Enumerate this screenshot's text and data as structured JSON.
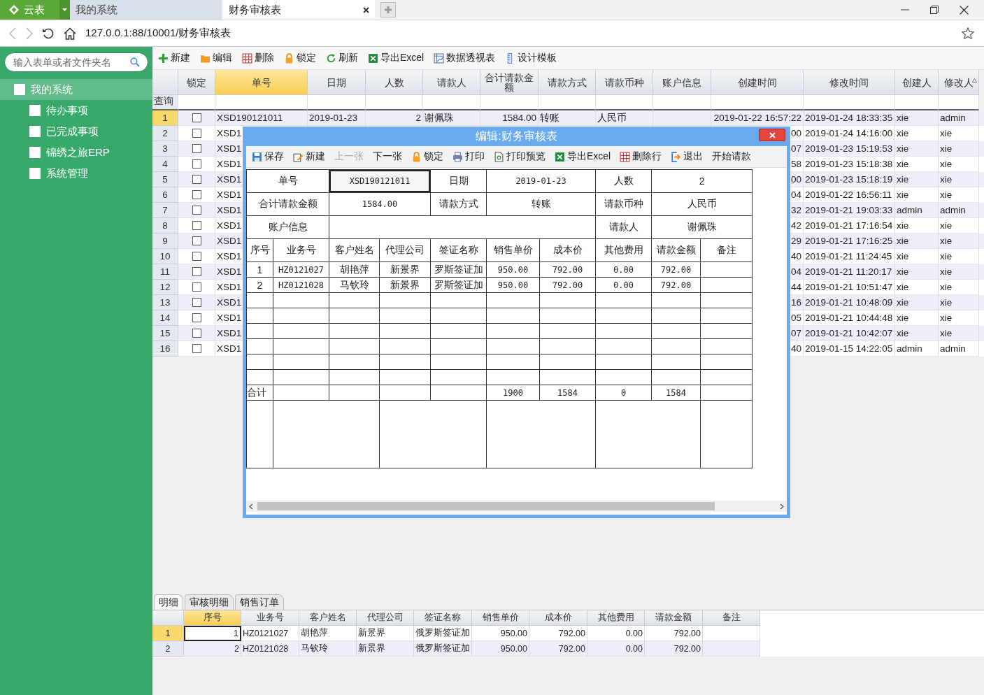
{
  "app_tab": {
    "label": "云表"
  },
  "tabs": [
    {
      "label": "我的系统",
      "selected": false
    },
    {
      "label": "财务审核表",
      "selected": true
    }
  ],
  "address": {
    "url": "127.0.0.1:88/10001/财务审核表"
  },
  "sidebar": {
    "search_placeholder": "输入表单或者文件夹名",
    "tree": [
      {
        "label": "我的系统",
        "selected": true,
        "children": [
          {
            "label": "待办事项",
            "selected": false
          },
          {
            "label": "已完成事项",
            "selected": false
          },
          {
            "label": "锦绣之旅ERP",
            "selected": false
          },
          {
            "label": "系统管理",
            "selected": false
          }
        ]
      }
    ]
  },
  "toolbar": [
    {
      "label": "新建",
      "kind": "plus"
    },
    {
      "label": "编辑",
      "kind": "folder"
    },
    {
      "label": "删除",
      "kind": "table"
    },
    {
      "label": "锁定",
      "kind": "lock"
    },
    {
      "label": "刷新",
      "kind": "refresh"
    },
    {
      "label": "导出Excel",
      "kind": "excel"
    },
    {
      "label": "数据透视表",
      "kind": "pivot"
    },
    {
      "label": "设计模板",
      "kind": "ruler"
    }
  ],
  "grid": {
    "query_label": "查询",
    "columns": [
      {
        "label": "锁定",
        "selected": false
      },
      {
        "label": "单号",
        "selected": true
      },
      {
        "label": "日期",
        "selected": false
      },
      {
        "label": "人数",
        "selected": false
      },
      {
        "label": "请款人",
        "selected": false
      },
      {
        "label": "合计请款金额",
        "selected": false
      },
      {
        "label": "请款方式",
        "selected": false
      },
      {
        "label": "请款币种",
        "selected": false
      },
      {
        "label": "账户信息",
        "selected": false
      },
      {
        "label": "创建时间",
        "selected": false
      },
      {
        "label": "修改时间",
        "selected": false
      },
      {
        "label": "创建人",
        "selected": false
      },
      {
        "label": "修改人",
        "selected": false
      }
    ],
    "rows": [
      {
        "index": "1",
        "selected": true,
        "locked": false,
        "order_no": "XSD190121011",
        "date": "2019-01-23",
        "people": "2",
        "requester": "谢佩珠",
        "total": "1584.00",
        "method": "转账",
        "currency": "人民币",
        "created": "2019-01-22 16:57:22",
        "modified": "2019-01-24 18:33:35",
        "creator": "xie",
        "modifier": "admin"
      },
      {
        "index": "2",
        "selected": false,
        "locked": false,
        "order_no": "XSD1",
        "created": "00",
        "modified": "2019-01-24 14:16:00",
        "creator": "xie",
        "modifier": "xie"
      },
      {
        "index": "3",
        "selected": false,
        "locked": false,
        "order_no": "XSD1",
        "created": "07",
        "modified": "2019-01-23 15:19:53",
        "creator": "xie",
        "modifier": "xie"
      },
      {
        "index": "4",
        "selected": false,
        "locked": false,
        "order_no": "XSD1",
        "created": "58",
        "modified": "2019-01-23 15:18:38",
        "creator": "xie",
        "modifier": "xie"
      },
      {
        "index": "5",
        "selected": false,
        "locked": false,
        "order_no": "XSD1",
        "created": "00",
        "modified": "2019-01-23 15:18:19",
        "creator": "xie",
        "modifier": "xie"
      },
      {
        "index": "6",
        "selected": false,
        "locked": false,
        "order_no": "XSD1",
        "created": "04",
        "modified": "2019-01-22 16:56:11",
        "creator": "xie",
        "modifier": "xie"
      },
      {
        "index": "7",
        "selected": false,
        "locked": false,
        "order_no": "XSD1",
        "created": "32",
        "modified": "2019-01-21 19:03:33",
        "creator": "admin",
        "modifier": "admin"
      },
      {
        "index": "8",
        "selected": false,
        "locked": false,
        "order_no": "XSD1",
        "created": "42",
        "modified": "2019-01-21 17:16:54",
        "creator": "xie",
        "modifier": "xie"
      },
      {
        "index": "9",
        "selected": false,
        "locked": false,
        "order_no": "XSD1",
        "created": "29",
        "modified": "2019-01-21 17:16:25",
        "creator": "xie",
        "modifier": "xie"
      },
      {
        "index": "10",
        "selected": false,
        "locked": false,
        "order_no": "XSD1",
        "created": "40",
        "modified": "2019-01-21 11:24:45",
        "creator": "xie",
        "modifier": "xie"
      },
      {
        "index": "11",
        "selected": false,
        "locked": false,
        "order_no": "XSD1",
        "created": "04",
        "modified": "2019-01-21 11:20:17",
        "creator": "xie",
        "modifier": "xie"
      },
      {
        "index": "12",
        "selected": false,
        "locked": false,
        "order_no": "XSD1",
        "created": "44",
        "modified": "2019-01-21 10:51:47",
        "creator": "xie",
        "modifier": "xie"
      },
      {
        "index": "13",
        "selected": false,
        "locked": false,
        "order_no": "XSD1",
        "created": "16",
        "modified": "2019-01-21 10:48:09",
        "creator": "xie",
        "modifier": "xie"
      },
      {
        "index": "14",
        "selected": false,
        "locked": false,
        "order_no": "XSD1",
        "created": "05",
        "modified": "2019-01-21 10:44:48",
        "creator": "xie",
        "modifier": "xie"
      },
      {
        "index": "15",
        "selected": false,
        "locked": false,
        "order_no": "XSD1",
        "created": "07",
        "modified": "2019-01-21 10:42:07",
        "creator": "xie",
        "modifier": "xie"
      },
      {
        "index": "16",
        "selected": false,
        "locked": false,
        "order_no": "XSD1",
        "created": "40",
        "modified": "2019-01-15 14:22:05",
        "creator": "admin",
        "modifier": "admin"
      }
    ]
  },
  "detail_tabs": [
    {
      "label": "明细",
      "selected": true
    },
    {
      "label": "审核明细",
      "selected": false
    },
    {
      "label": "销售订单",
      "selected": false
    }
  ],
  "detail_grid": {
    "columns": [
      {
        "label": "序号",
        "selected": true
      },
      {
        "label": "业务号",
        "selected": false
      },
      {
        "label": "客户姓名",
        "selected": false
      },
      {
        "label": "代理公司",
        "selected": false
      },
      {
        "label": "签证名称",
        "selected": false
      },
      {
        "label": "销售单价",
        "selected": false
      },
      {
        "label": "成本价",
        "selected": false
      },
      {
        "label": "其他费用",
        "selected": false
      },
      {
        "label": "请款金额",
        "selected": false
      },
      {
        "label": "备注",
        "selected": false
      }
    ],
    "rows": [
      {
        "index": "1",
        "selected": true,
        "cells": [
          "1",
          "HZ0121027",
          "胡艳萍",
          "新景界",
          "俄罗斯签证加",
          "950.00",
          "792.00",
          "0.00",
          "792.00"
        ]
      },
      {
        "index": "2",
        "selected": false,
        "cells": [
          "2",
          "HZ0121028",
          "马钦玲",
          "新景界",
          "俄罗斯签证加",
          "950.00",
          "792.00",
          "0.00",
          "792.00"
        ]
      }
    ]
  },
  "dialog": {
    "title": "编辑:财务审核表",
    "toolbar": [
      {
        "label": "保存",
        "kind": "save",
        "disabled": false
      },
      {
        "label": "新建",
        "kind": "edit",
        "disabled": false
      },
      {
        "label": "上一张",
        "kind": "text",
        "disabled": true
      },
      {
        "label": "下一张",
        "kind": "text",
        "disabled": false
      },
      {
        "label": "锁定",
        "kind": "lock",
        "disabled": false
      },
      {
        "label": "打印",
        "kind": "print",
        "disabled": false
      },
      {
        "label": "打印预览",
        "kind": "preview",
        "disabled": false
      },
      {
        "label": "导出Excel",
        "kind": "excel",
        "disabled": false
      },
      {
        "label": "删除行",
        "kind": "table",
        "disabled": false
      },
      {
        "label": "退出",
        "kind": "exit",
        "disabled": false
      },
      {
        "label": "开始请款",
        "kind": "text",
        "disabled": false
      }
    ],
    "fields": [
      {
        "label": "单号",
        "value": "XSD190121011",
        "selected": true
      },
      {
        "label": "日期",
        "value": "2019-01-23",
        "selected": false
      },
      {
        "label": "人数",
        "value": "2",
        "selected": false
      },
      {
        "label": "合计请款金额",
        "value": "1584.00",
        "selected": false
      },
      {
        "label": "请款方式",
        "value": "转账",
        "selected": false
      },
      {
        "label": "请款币种",
        "value": "人民币",
        "selected": false
      }
    ],
    "account": {
      "label": "账户信息",
      "requester_label": "请款人",
      "requester": "谢佩珠"
    },
    "columns": [
      "序号",
      "业务号",
      "客户姓名",
      "代理公司",
      "签证名称",
      "销售单价",
      "成本价",
      "其他费用",
      "请款金额",
      "备注"
    ],
    "rows": [
      [
        "1",
        "HZ0121027",
        "胡艳萍",
        "新景界",
        "罗斯签证加",
        "950.00",
        "792.00",
        "0.00",
        "792.00"
      ],
      [
        "2",
        "HZ0121028",
        "马钦玲",
        "新景界",
        "罗斯签证加",
        "950.00",
        "792.00",
        "0.00",
        "792.00"
      ]
    ],
    "totals": {
      "label": "合计",
      "sales_price": "1900",
      "cost": "1584",
      "other_fees": "0",
      "amount": "1584"
    }
  }
}
